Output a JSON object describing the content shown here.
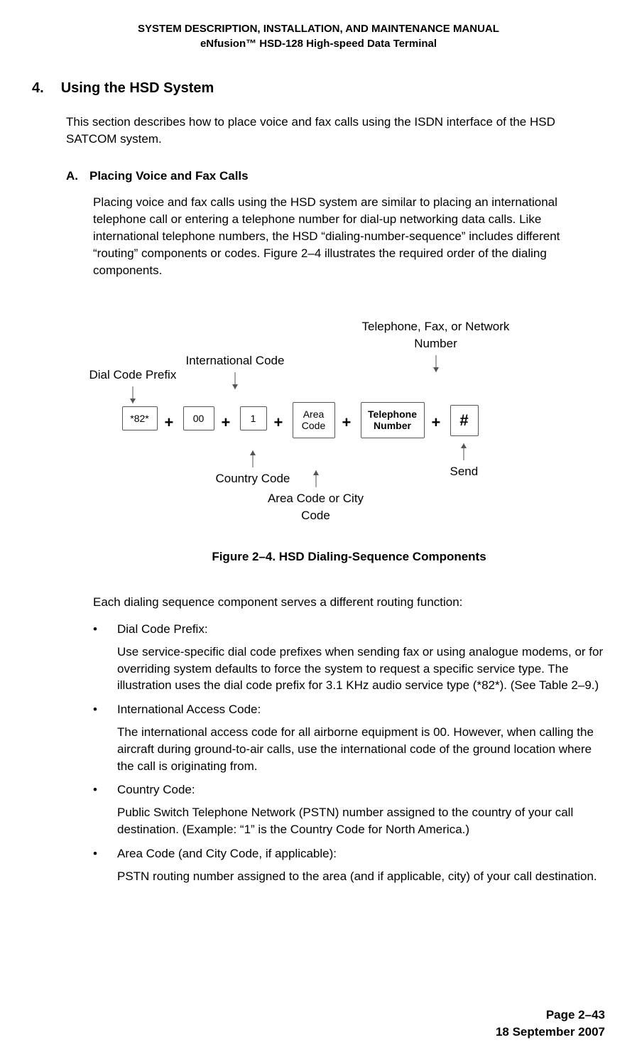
{
  "header": {
    "line1": "SYSTEM DESCRIPTION, INSTALLATION, AND MAINTENANCE MANUAL",
    "line2": "eNfusion™ HSD-128 High-speed Data Terminal"
  },
  "section": {
    "number": "4.",
    "title": "Using the HSD System",
    "intro": "This section describes how to place voice and fax calls using the ISDN interface of the HSD SATCOM system."
  },
  "subsection": {
    "letter": "A.",
    "title": "Placing Voice and Fax Calls",
    "body": "Placing voice and fax calls using the HSD system are similar to placing an international telephone call or entering a telephone number for dial-up networking data calls. Like international telephone numbers, the HSD “dialing-number-sequence” includes different “routing” components or codes. Figure 2–4 illustrates the required order of the dialing components."
  },
  "diagram": {
    "labels": {
      "dial_code_prefix": "Dial Code Prefix",
      "international_code": "International Code",
      "country_code": "Country Code",
      "area_code_city": "Area Code or City Code",
      "telephone_fax_network": "Telephone, Fax, or Network Number",
      "send": "Send"
    },
    "boxes": {
      "prefix": "*82*",
      "intl": "00",
      "country": "1",
      "area": "Area Code",
      "telephone": "Telephone Number",
      "hash": "#"
    },
    "plus": "+"
  },
  "figure_caption": "Figure 2–4. HSD Dialing-Sequence Components",
  "bullets_intro": "Each dialing sequence component serves a different routing function:",
  "bullets": [
    {
      "title": "Dial Code Prefix:",
      "body": "Use service-specific dial code prefixes when sending fax or using analogue modems, or for overriding system defaults to force the system to request a specific service type. The illustration uses the dial code prefix for 3.1 KHz audio service type (*82*). (See Table 2–9.)"
    },
    {
      "title": "International Access Code:",
      "body": "The international access code for all airborne equipment is 00. However, when calling the aircraft during ground-to-air calls, use the international code of the ground location where the call is originating from."
    },
    {
      "title": "Country Code:",
      "body": "Public Switch Telephone Network (PSTN) number assigned to the country of your call destination. (Example: “1” is the Country Code for North America.)"
    },
    {
      "title": "Area Code (and City Code, if applicable):",
      "body": "PSTN routing number assigned to the area (and if applicable, city) of your call destination."
    }
  ],
  "footer": {
    "page": "Page 2–43",
    "date": "18 September 2007"
  }
}
